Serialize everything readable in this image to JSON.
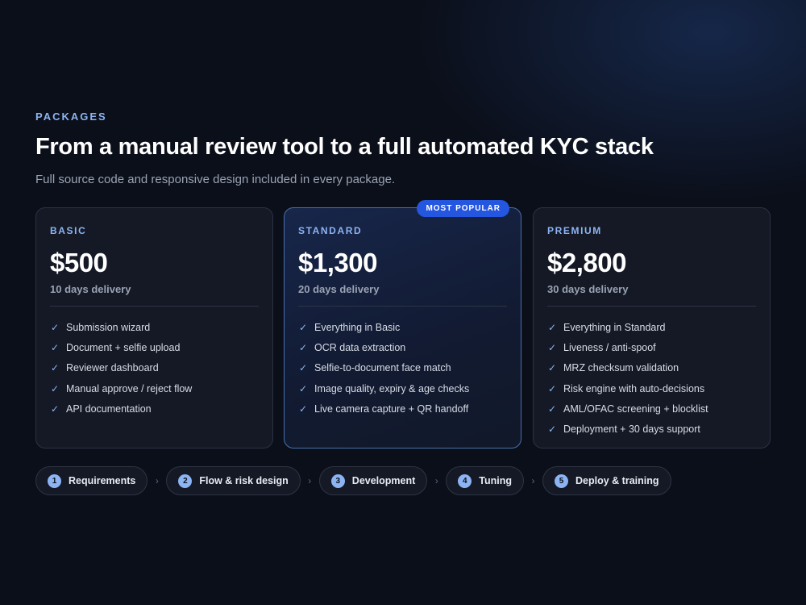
{
  "section": {
    "eyebrow": "PACKAGES",
    "title": "From a manual review tool to a full automated KYC stack",
    "subtitle": "Full source code and responsive design included in every package."
  },
  "packages": [
    {
      "tier": "BASIC",
      "price": "$500",
      "delivery": "10 days delivery",
      "features": [
        "Submission wizard",
        "Document + selfie upload",
        "Reviewer dashboard",
        "Manual approve / reject flow",
        "API documentation"
      ]
    },
    {
      "tier": "STANDARD",
      "badge": "MOST POPULAR",
      "price": "$1,300",
      "delivery": "20 days delivery",
      "features": [
        "Everything in Basic",
        "OCR data extraction",
        "Selfie-to-document face match",
        "Image quality, expiry & age checks",
        "Live camera capture + QR handoff"
      ]
    },
    {
      "tier": "PREMIUM",
      "price": "$2,800",
      "delivery": "30 days delivery",
      "features": [
        "Everything in Standard",
        "Liveness / anti-spoof",
        "MRZ checksum validation",
        "Risk engine with auto-decisions",
        "AML/OFAC screening + blocklist",
        "Deployment + 30 days support"
      ]
    }
  ],
  "process_steps": [
    {
      "number": "1",
      "label": "Requirements"
    },
    {
      "number": "2",
      "label": "Flow & risk design"
    },
    {
      "number": "3",
      "label": "Development"
    },
    {
      "number": "4",
      "label": "Tuning"
    },
    {
      "number": "5",
      "label": "Deploy & training"
    }
  ],
  "icons": {
    "feature_bullet": "check-icon",
    "step_separator": "chevron-right-icon"
  },
  "colors": {
    "background": "#0b0f1a",
    "accent": "#8db4f2",
    "badge": "#2456e0",
    "card": "#141925",
    "featured_border": "#4a6fae"
  }
}
